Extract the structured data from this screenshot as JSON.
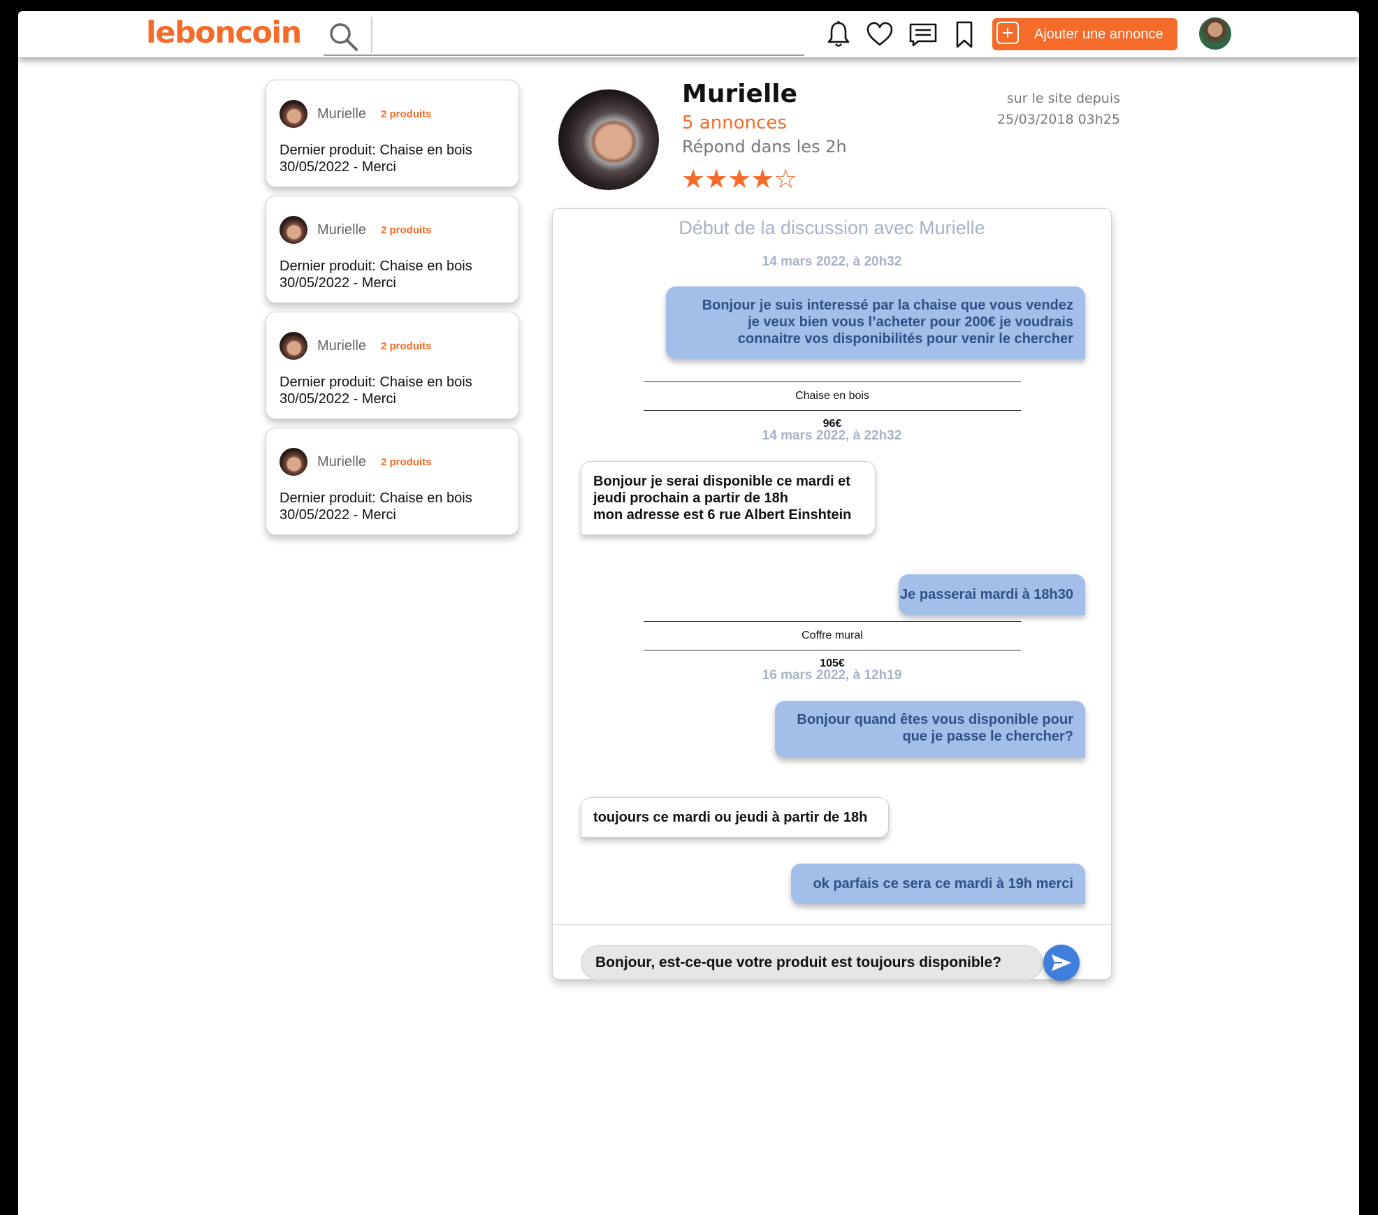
{
  "header": {
    "logo": "leboncoin",
    "search": {
      "value": "",
      "placeholder": ""
    },
    "icons": [
      "bell-icon",
      "heart-icon",
      "messages-icon",
      "bookmark-icon"
    ],
    "add_button_label": "Ajouter une annonce",
    "accent_color": "#f56b2a"
  },
  "conversations": [
    {
      "name": "Murielle",
      "badge": "2 produits",
      "line1": "Dernier produit: Chaise en bois",
      "line2": "30/05/2022 - Merci"
    },
    {
      "name": "Murielle",
      "badge": "2 produits",
      "line1": "Dernier produit: Chaise en bois",
      "line2": "30/05/2022 - Merci"
    },
    {
      "name": "Murielle",
      "badge": "2 produits",
      "line1": "Dernier produit: Chaise en bois",
      "line2": "30/05/2022 - Merci"
    },
    {
      "name": "Murielle",
      "badge": "2 produits",
      "line1": "Dernier produit: Chaise en bois",
      "line2": "30/05/2022 - Merci"
    }
  ],
  "profile": {
    "name": "Murielle",
    "ads": "5 annonces",
    "response": "Répond dans les 2h",
    "rating": 4,
    "rating_max": 5,
    "stars_text": "★★★★☆",
    "member_since_label": "sur le site depuis",
    "member_since_date": "25/03/2018 03h25"
  },
  "chat": {
    "title": "Début de la discussion avec Murielle",
    "dates": [
      "14 mars 2022, à 20h32",
      "14 mars 2022, à 22h32",
      "16 mars 2022, à 12h19"
    ],
    "products": [
      {
        "name": "Chaise en bois ",
        "price": "96€"
      },
      {
        "name": "Coffre mural ",
        "price": "105€"
      }
    ],
    "messages": [
      {
        "from": "me",
        "lines": [
          "Bonjour je suis interessé par la chaise que vous vendez",
          "je veux bien vous l’acheter pour 200€ je voudrais",
          "connaitre vos disponibilités pour venir le chercher"
        ]
      },
      {
        "from": "seller",
        "lines": [
          "Bonjour je serai disponible ce mardi et",
          "jeudi prochain a partir de 18h",
          "mon adresse est 6 rue Albert Einshtein"
        ]
      },
      {
        "from": "me",
        "lines": [
          "Je passerai mardi à 18h30"
        ]
      },
      {
        "from": "me",
        "lines": [
          "Bonjour quand êtes vous disponible pour",
          "que je passe le chercher?"
        ]
      },
      {
        "from": "seller",
        "lines": [
          "toujours ce mardi ou jeudi à partir de 18h"
        ]
      },
      {
        "from": "me",
        "lines": [
          "ok parfais ce sera ce mardi à 19h merci"
        ]
      }
    ],
    "input": {
      "value": "Bonjour, est-ce-que votre produit est toujours disponible?",
      "placeholder": ""
    },
    "outgoing_color": "#a3bfe9",
    "send_color": "#3f7fdc"
  }
}
